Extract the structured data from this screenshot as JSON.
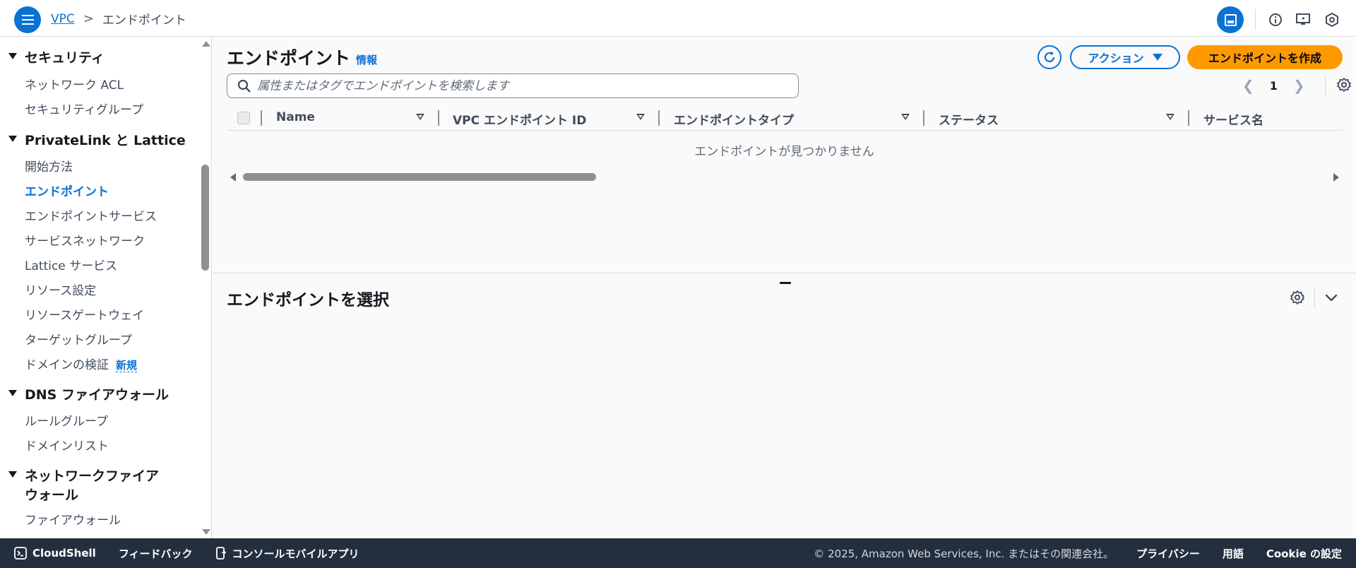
{
  "header": {
    "breadcrumb_root": "VPC",
    "breadcrumb_sep": ">",
    "breadcrumb_current": "エンドポイント"
  },
  "sidebar": {
    "sections": [
      {
        "title": "セキュリティ",
        "items": [
          "ネットワーク ACL",
          "セキュリティグループ"
        ]
      },
      {
        "title": "PrivateLink と Lattice",
        "items": [
          "開始方法",
          "エンドポイント",
          "エンドポイントサービス",
          "サービスネットワーク",
          "Lattice サービス",
          "リソース設定",
          "リソースゲートウェイ",
          "ターゲットグループ",
          "ドメインの検証"
        ]
      },
      {
        "title": "DNS ファイアウォール",
        "items": [
          "ルールグループ",
          "ドメインリスト"
        ]
      },
      {
        "title": "ネットワークファイア",
        "title2": "ウォール",
        "items": [
          "ファイアウォール"
        ]
      }
    ],
    "active_item": "エンドポイント",
    "new_badge": "新規"
  },
  "main": {
    "title": "エンドポイント",
    "info_link": "情報",
    "actions_label": "アクション",
    "create_label": "エンドポイントを作成",
    "search_placeholder": "属性またはタグでエンドポイントを検索します",
    "page_number": "1",
    "columns": [
      "Name",
      "VPC エンドポイント ID",
      "エンドポイントタイプ",
      "ステータス",
      "サービス名"
    ],
    "empty_message": "エンドポイントが見つかりません",
    "detail_title": "エンドポイントを選択"
  },
  "footer": {
    "cloudshell": "CloudShell",
    "feedback": "フィードバック",
    "mobile_app": "コンソールモバイルアプリ",
    "copyright": "© 2025, Amazon Web Services, Inc. またはその関連会社。",
    "privacy": "プライバシー",
    "terms": "用語",
    "cookie": "Cookie の設定"
  },
  "colors": {
    "accent": "#0972d3",
    "primary_button": "#ff9900",
    "footer_bg": "#232f3e"
  }
}
